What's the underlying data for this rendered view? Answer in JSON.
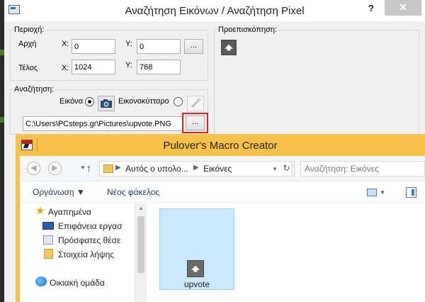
{
  "dialog": {
    "title": "Αναζήτηση Εικόνων / Αναζήτηση Pixel",
    "help_label": "?",
    "close_label": "✕",
    "region": {
      "label": "Περιοχή:",
      "start_label": "Αρχή",
      "end_label": "Τέλος",
      "x_label": "X:",
      "y_label": "Y:",
      "start_x": "0",
      "start_y": "0",
      "end_x": "1024",
      "end_y": "768",
      "pick_button_label": "..."
    },
    "preview": {
      "label": "Προεπισκόπηση:"
    },
    "search": {
      "label": "Αναζήτηση:",
      "image_label": "Εικόνα",
      "pixel_label": "Εικονοκύτταρο",
      "image_selected": true,
      "path_value": "C:\\Users\\PCsteps.gr\\Pictures\\upvote.PNG",
      "browse_label": "..."
    }
  },
  "explorer": {
    "title": "Pulover's Macro Creator",
    "address": {
      "segment1": "Αυτός ο υπολο...",
      "segment2": "Εικόνες",
      "chevron": "▶"
    },
    "search_placeholder": "Αναζήτηση: Εικόνες",
    "commands": {
      "organize": "Οργάνωση ▼",
      "new_folder": "Νέος φάκελος"
    },
    "nav": {
      "favorites": "Αγαπημένα",
      "desktop": "Επιφάνεια εργασ",
      "recent": "Πρόσφατες θέσε",
      "downloads": "Στοιχεία λήψης",
      "homegroup": "Οικιακή ομάδα"
    },
    "files": [
      {
        "name": "upvote"
      }
    ]
  },
  "colors": {
    "highlight": "#e31b1b",
    "explorer_frame": "#f8c24a",
    "selection": "#cce8ff"
  }
}
